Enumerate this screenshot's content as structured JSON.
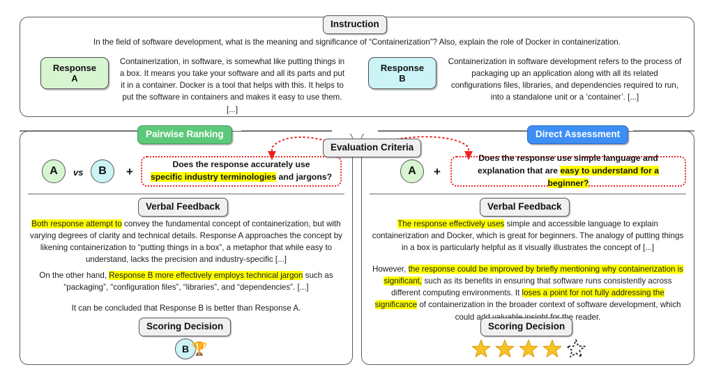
{
  "instruction": {
    "label": "Instruction",
    "text": "In the field of software development, what is the meaning and significance of “Containerization”? Also, explain the role of Docker in containerization."
  },
  "responses": [
    {
      "chip_line1": "Response",
      "chip_line2": "A",
      "color": "#d8f5d2",
      "text": "Containerization, in software, is somewhat like putting things in a box. It means you take your software and all its parts and put it in a container. Docker is a tool that helps with this. It helps to put the software in containers and makes it easy to use them. [...]"
    },
    {
      "chip_line1": "Response",
      "chip_line2": "B",
      "color": "#ccf3f6",
      "text": "Containerization in software development refers to the process of packaging up an application along with all its related configurations files, libraries, and dependencies required to run, into a standalone unit or a ‘container’. [...]"
    }
  ],
  "evaluation_criteria_label": "Evaluation Criteria",
  "panels": [
    {
      "tag": "Pairwise Ranking",
      "tag_color": "#5cc97a",
      "inputs": {
        "left_circle": "A",
        "vs": "vs",
        "right_circle": "B",
        "plus": "+"
      },
      "criteria": {
        "line1_plain": "Does the response accurately use",
        "line2_hl": "specific industry terminologies",
        "line2_plain": " and jargons?"
      },
      "feedback_label": "Verbal Feedback",
      "feedback": {
        "p1_hl": "Both response attempt to",
        "p1_rest": " convey the fundamental concept of containerization, but with varying degrees of clarity and technical details. Response A approaches the concept by likening containerization to “putting things in a box”, a metaphor that while easy to understand, lacks the precision and industry-specific [...]",
        "p2_pre": "On the other hand, ",
        "p2_hl": "Response B more effectively employs technical jargon",
        "p2_rest": " such as “packaging”, “configuration files”, “libraries”, and “dependencies”. [...]",
        "p3": "It can be concluded that Response B is better than Response A."
      },
      "scoring_label": "Scoring Decision",
      "verdict": {
        "winner": "B",
        "trophy": "🏆"
      }
    },
    {
      "tag": "Direct Assessment",
      "tag_color": "#3d8ef5",
      "inputs": {
        "left_circle": "A",
        "plus": "+"
      },
      "criteria": {
        "line1_plain": "Does the response use simple language and",
        "line2_plain": "explanation that are ",
        "line2_hl": "easy to understand for a beginner?"
      },
      "feedback_label": "Verbal Feedback",
      "feedback": {
        "p1_hl": "The response effectively uses",
        "p1_rest": " simple and accessible language to explain containerization and Docker, which is great for beginners. The analogy of putting things in a box is particularly helpful as it visually illustrates the concept of [...]",
        "p2_pre": "However, ",
        "p2_hl1": "the response could be improved by briefly mentioning why containerization is significant,",
        "p2_mid": " such as its benefits in ensuring that software runs consistently across different computing environments.  It ",
        "p2_hl2": "loses a point for not fully addressing the significance",
        "p2_rest": " of containerization in the broader context of software development, which could add valuable insight for the reader."
      },
      "scoring_label": "Scoring Decision",
      "verdict": {
        "stars_filled": 4,
        "stars_total": 5
      }
    }
  ]
}
